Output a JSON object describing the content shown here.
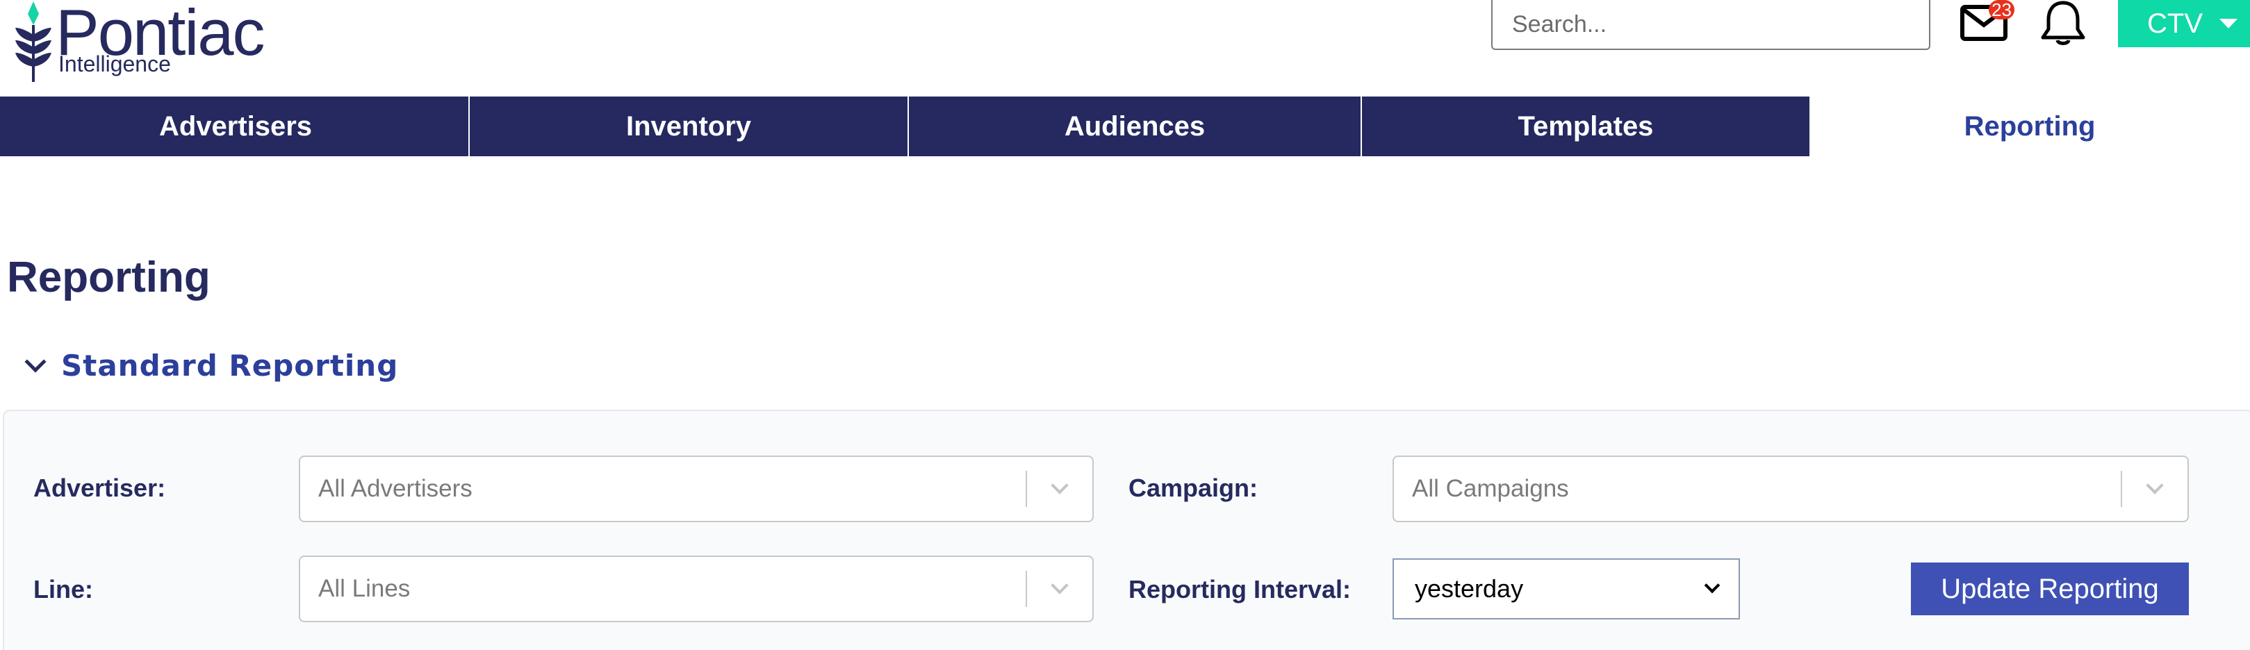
{
  "header": {
    "logo_word": "Pontiac",
    "logo_sub": "Intelligence",
    "search_placeholder": "Search...",
    "mail_badge": "23",
    "ctv_label": "CTV"
  },
  "tabs": [
    {
      "label": "Advertisers",
      "active": false
    },
    {
      "label": "Inventory",
      "active": false
    },
    {
      "label": "Audiences",
      "active": false
    },
    {
      "label": "Templates",
      "active": false
    },
    {
      "label": "Reporting",
      "active": true
    }
  ],
  "page": {
    "title": "Reporting",
    "section_title": "Standard Reporting"
  },
  "filters": {
    "advertiser_label": "Advertiser:",
    "advertiser_value": "All Advertisers",
    "campaign_label": "Campaign:",
    "campaign_value": "All Campaigns",
    "line_label": "Line:",
    "line_value": "All Lines",
    "interval_label": "Reporting Interval:",
    "interval_value": "yesterday",
    "update_label": "Update Reporting"
  },
  "colors": {
    "navy": "#252960",
    "accent_blue": "#2c3f9b",
    "teal": "#0fd9a6",
    "button_blue": "#3f51b5",
    "badge_red": "#e8321c"
  }
}
